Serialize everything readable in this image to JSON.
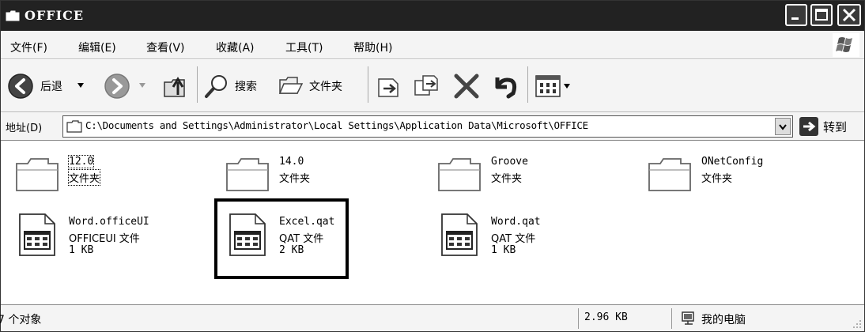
{
  "window": {
    "title": "OFFICE"
  },
  "menubar": {
    "items": [
      {
        "label": "文件(F)"
      },
      {
        "label": "编辑(E)"
      },
      {
        "label": "查看(V)"
      },
      {
        "label": "收藏(A)"
      },
      {
        "label": "工具(T)"
      },
      {
        "label": "帮助(H)"
      }
    ]
  },
  "toolbar": {
    "back_label": "后退",
    "search_label": "搜索",
    "folders_label": "文件夹",
    "icons": [
      "back-arrow-icon",
      "forward-arrow-icon",
      "up-folder-icon",
      "search-icon",
      "folders-icon",
      "move-to-icon",
      "copy-to-icon",
      "delete-icon",
      "undo-icon",
      "views-icon"
    ]
  },
  "address": {
    "label": "地址(D)",
    "path": "C:\\Documents and Settings\\Administrator\\Local Settings\\Application Data\\Microsoft\\OFFICE",
    "go_label": "转到"
  },
  "files": [
    {
      "name": "12.0",
      "type": "文件夹",
      "size": "",
      "kind": "folder"
    },
    {
      "name": "14.0",
      "type": "文件夹",
      "size": "",
      "kind": "folder"
    },
    {
      "name": "Groove",
      "type": "文件夹",
      "size": "",
      "kind": "folder"
    },
    {
      "name": "ONetConfig",
      "type": "文件夹",
      "size": "",
      "kind": "folder"
    },
    {
      "name": "Word.officeUI",
      "type": "OFFICEUI 文件",
      "size": "1 KB",
      "kind": "file"
    },
    {
      "name": "Excel.qat",
      "type": "QAT 文件",
      "size": "2 KB",
      "kind": "file"
    },
    {
      "name": "Word.qat",
      "type": "QAT 文件",
      "size": "1 KB",
      "kind": "file"
    }
  ],
  "statusbar": {
    "object_count": "7 个对象",
    "total_size": "2.96 KB",
    "location": "我的电脑"
  },
  "colors": {
    "titlebar": "#222222",
    "chrome": "#f4f4f4"
  }
}
